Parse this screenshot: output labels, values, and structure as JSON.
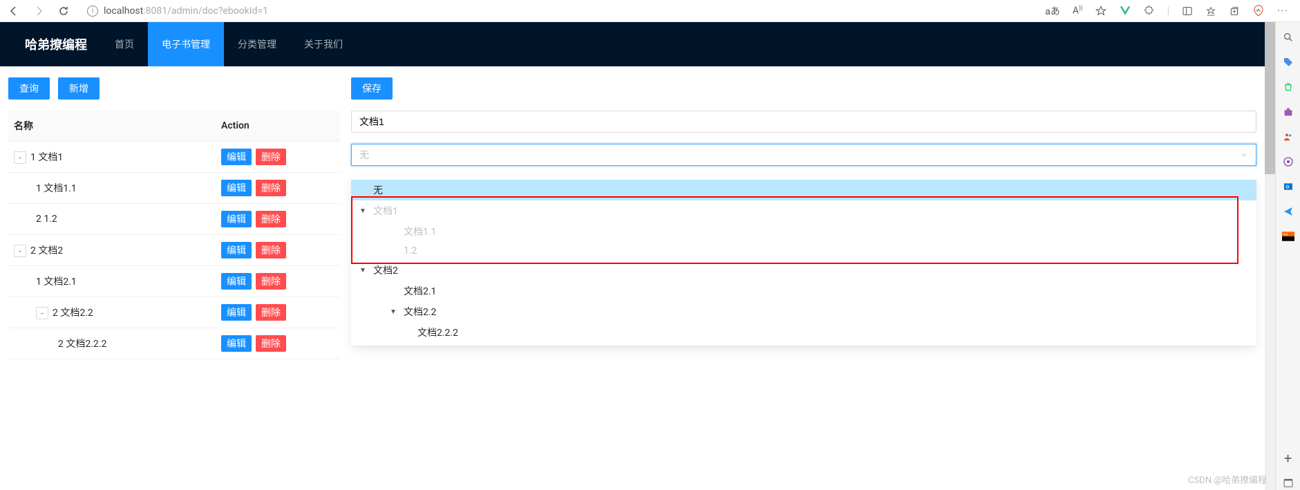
{
  "browser": {
    "url_host": "localhost",
    "url_rest": ":8081/admin/doc?ebookId=1",
    "read_aloud": "aあ",
    "font_label": "A"
  },
  "header": {
    "logo": "哈弟撩编程",
    "nav": [
      {
        "label": "首页",
        "active": false
      },
      {
        "label": "电子书管理",
        "active": true
      },
      {
        "label": "分类管理",
        "active": false
      },
      {
        "label": "关于我们",
        "active": false
      }
    ]
  },
  "left": {
    "buttons": {
      "query": "查询",
      "add": "新增"
    },
    "columns": {
      "name": "名称",
      "action": "Action"
    },
    "action_labels": {
      "edit": "编辑",
      "del": "删除"
    },
    "rows": [
      {
        "expander": "-",
        "indent": 0,
        "text": "1 文档1"
      },
      {
        "expander": "",
        "indent": 1,
        "text": "1 文档1.1"
      },
      {
        "expander": "",
        "indent": 1,
        "text": "2 1.2"
      },
      {
        "expander": "-",
        "indent": 0,
        "text": "2 文档2"
      },
      {
        "expander": "",
        "indent": 1,
        "text": "1 文档2.1"
      },
      {
        "expander": "-",
        "indent": 1,
        "text": "2 文档2.2"
      },
      {
        "expander": "",
        "indent": 2,
        "text": "2 文档2.2.2"
      }
    ]
  },
  "right": {
    "save": "保存",
    "name_value": "文档1",
    "select_placeholder": "无",
    "dropdown": [
      {
        "caret": "",
        "indent": 0,
        "label": "无",
        "selected": true,
        "disabled": false
      },
      {
        "caret": "▼",
        "indent": 0,
        "label": "文档1",
        "selected": false,
        "disabled": true
      },
      {
        "caret": "",
        "indent": 2,
        "label": "文档1.1",
        "selected": false,
        "disabled": true
      },
      {
        "caret": "",
        "indent": 2,
        "label": "1.2",
        "selected": false,
        "disabled": true
      },
      {
        "caret": "▼",
        "indent": 0,
        "label": "文档2",
        "selected": false,
        "disabled": false
      },
      {
        "caret": "",
        "indent": 2,
        "label": "文档2.1",
        "selected": false,
        "disabled": false
      },
      {
        "caret": "▼",
        "indent": 2,
        "label": "文档2.2",
        "selected": false,
        "disabled": false
      },
      {
        "caret": "",
        "indent": 3,
        "label": "文档2.2.2",
        "selected": false,
        "disabled": false
      }
    ]
  },
  "watermark": "CSDN @哈弟撩编程"
}
